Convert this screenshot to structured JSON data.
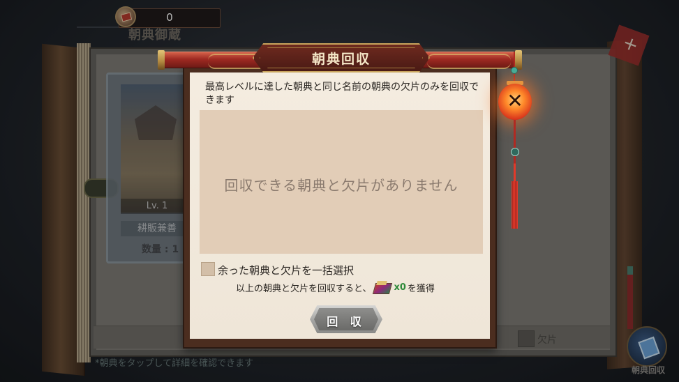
{
  "topbar": {
    "currency_icon": "book-fragment-icon",
    "currency_value": "0",
    "page_title": "朝典御蔵"
  },
  "background": {
    "card": {
      "level": "Lv. 1",
      "name": "耕販兼善",
      "count": "数量 : 1"
    },
    "piece_filter_label": "欠片",
    "hint": "*朝典をタップして詳細を確認できます",
    "recycle_entry_label": "朝典回収"
  },
  "dialog": {
    "title": "朝典回収",
    "description": "最高レベルに達した朝典と同じ名前の朝典の欠片のみを回収できます",
    "empty_message": "回収できる朝典と欠片がありません",
    "select_all_label": "余った朝典と欠片を一括選択",
    "select_all_checked": false,
    "reward_prefix": "以上の朝典と欠片を回収すると、",
    "reward_icon": "book-bundle-icon",
    "reward_amount": "x0",
    "reward_suffix": "を獲得",
    "recycle_button_label": "回 収",
    "recycle_button_enabled": false,
    "close_icon": "close-icon"
  },
  "colors": {
    "dialog_paper": "#efe6d8",
    "empty_panel": "#e2cdb7",
    "reward_amount": "#2e8a3a",
    "title_plate": "#5a2218",
    "lantern": "#ff8a2a"
  }
}
